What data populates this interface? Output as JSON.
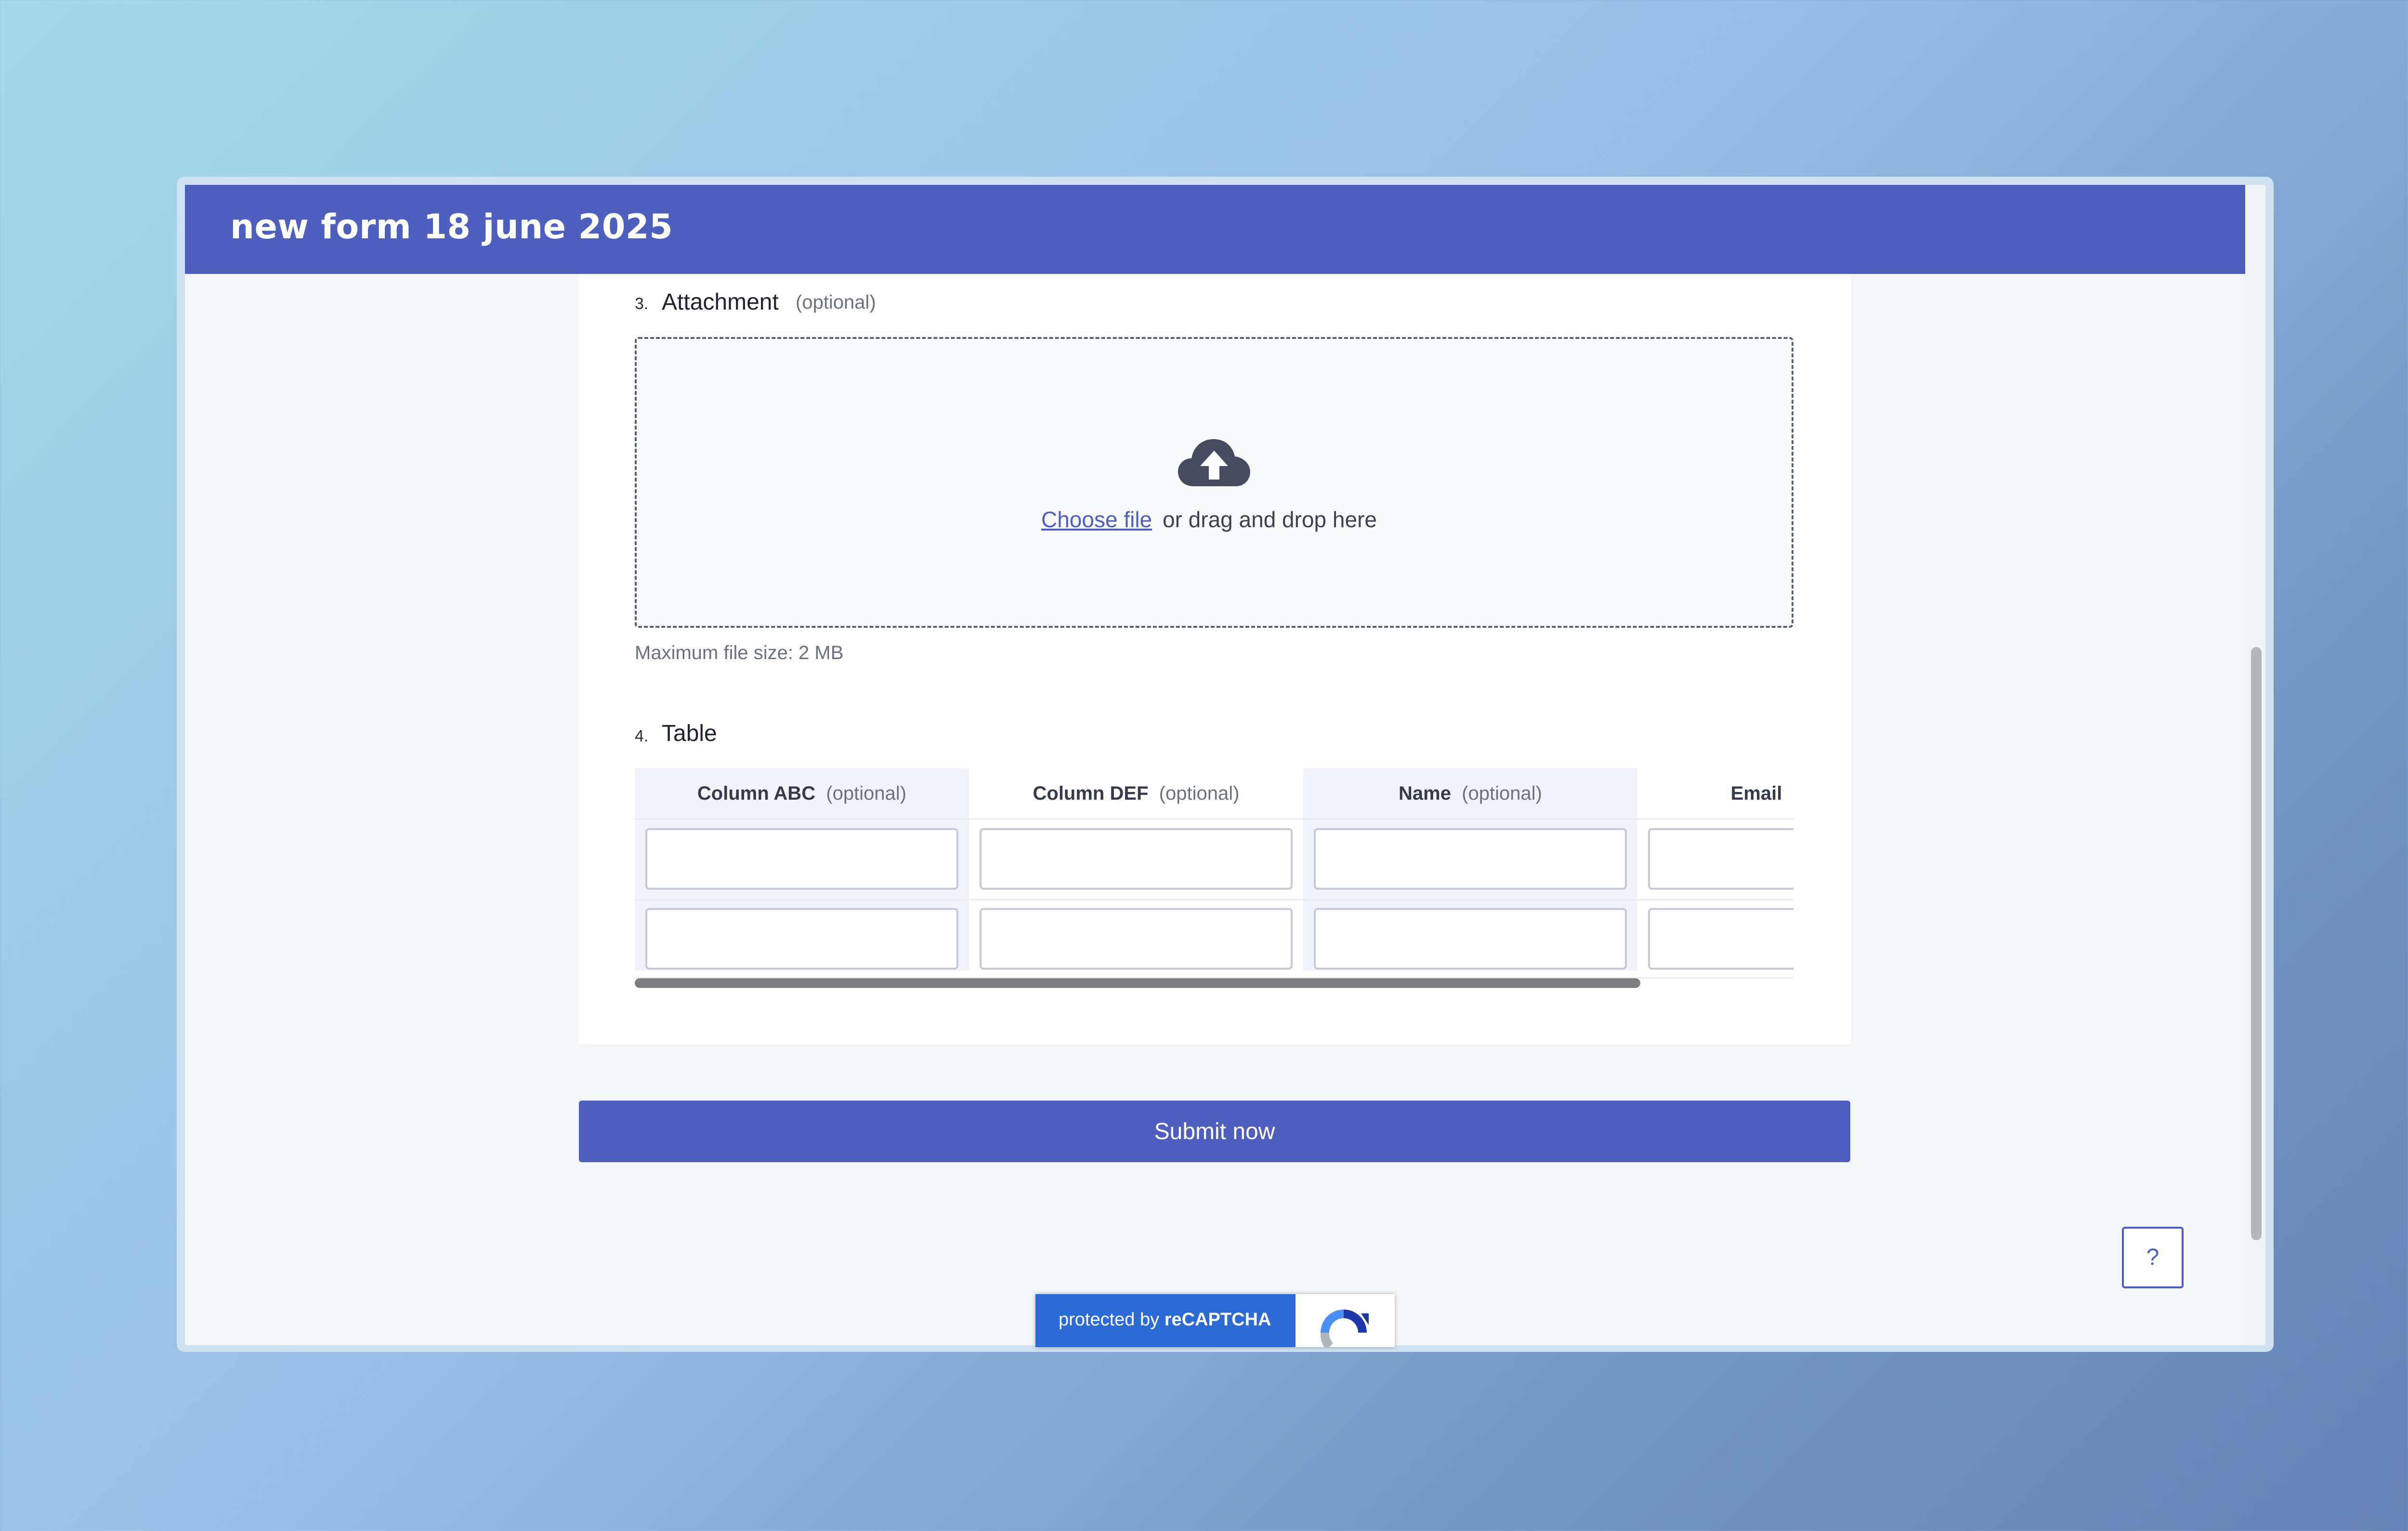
{
  "form": {
    "title": "new form 18 june 2025"
  },
  "attachment": {
    "number": "3.",
    "label": "Attachment",
    "optional": "(optional)",
    "choose_file": "Choose file",
    "drop_text": "or drag and drop here",
    "max_size": "Maximum file size: 2 MB",
    "icon": "cloud-upload-icon"
  },
  "table": {
    "number": "4.",
    "label": "Table",
    "columns": [
      {
        "name": "Column ABC",
        "optional": "(optional)"
      },
      {
        "name": "Column DEF",
        "optional": "(optional)"
      },
      {
        "name": "Name",
        "optional": "(optional)"
      },
      {
        "name": "Email",
        "optional": ""
      }
    ],
    "rows": [
      [
        "",
        "",
        "",
        ""
      ],
      [
        "",
        "",
        "",
        ""
      ]
    ]
  },
  "submit_label": "Submit now",
  "help_label": "?",
  "recaptcha": {
    "prefix": "protected by",
    "brand": "reCAPTCHA"
  },
  "colors": {
    "accent": "#4f5fbd",
    "recaptcha_blue": "#2c6ad6"
  }
}
